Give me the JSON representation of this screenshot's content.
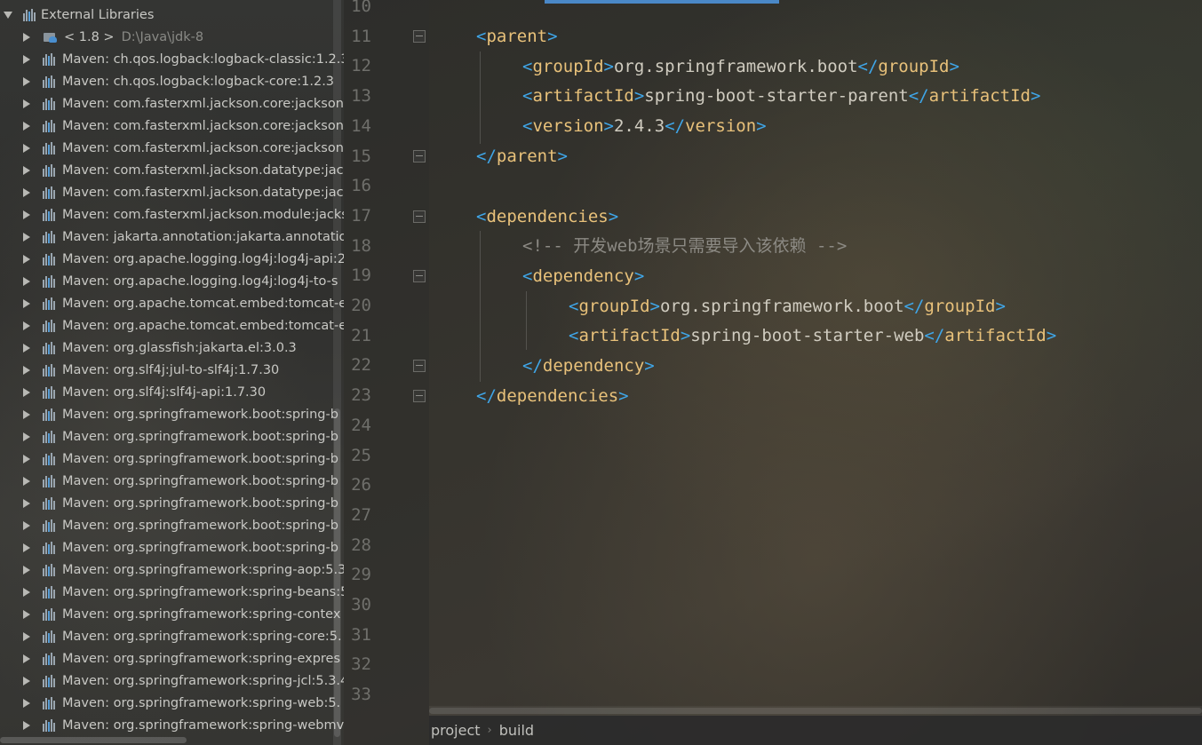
{
  "project_tree": {
    "root_label": "External Libraries",
    "jdk": {
      "label": "< 1.8 >",
      "path": "D:\\Java\\jdk-8"
    },
    "libraries": [
      "Maven: ch.qos.logback:logback-classic:1.2.3",
      "Maven: ch.qos.logback:logback-core:1.2.3",
      "Maven: com.fasterxml.jackson.core:jackson-",
      "Maven: com.fasterxml.jackson.core:jackson-",
      "Maven: com.fasterxml.jackson.core:jackson-",
      "Maven: com.fasterxml.jackson.datatype:jack",
      "Maven: com.fasterxml.jackson.datatype:jack",
      "Maven: com.fasterxml.jackson.module:jacks",
      "Maven: jakarta.annotation:jakarta.annotatio",
      "Maven: org.apache.logging.log4j:log4j-api:2",
      "Maven: org.apache.logging.log4j:log4j-to-s",
      "Maven: org.apache.tomcat.embed:tomcat-e",
      "Maven: org.apache.tomcat.embed:tomcat-e",
      "Maven: org.glassfish:jakarta.el:3.0.3",
      "Maven: org.slf4j:jul-to-slf4j:1.7.30",
      "Maven: org.slf4j:slf4j-api:1.7.30",
      "Maven: org.springframework.boot:spring-b",
      "Maven: org.springframework.boot:spring-b",
      "Maven: org.springframework.boot:spring-b",
      "Maven: org.springframework.boot:spring-b",
      "Maven: org.springframework.boot:spring-b",
      "Maven: org.springframework.boot:spring-b",
      "Maven: org.springframework.boot:spring-b",
      "Maven: org.springframework:spring-aop:5.3",
      "Maven: org.springframework:spring-beans:5",
      "Maven: org.springframework:spring-contex",
      "Maven: org.springframework:spring-core:5.",
      "Maven: org.springframework:spring-expres",
      "Maven: org.springframework:spring-jcl:5.3.4",
      "Maven: org.springframework:spring-web:5.",
      "Maven: org.springframework:spring-webmv"
    ]
  },
  "editor": {
    "line_numbers": [
      "10",
      "11",
      "12",
      "13",
      "14",
      "15",
      "16",
      "17",
      "18",
      "19",
      "20",
      "21",
      "22",
      "23",
      "24",
      "25",
      "26",
      "27",
      "28",
      "29",
      "30",
      "31",
      "32",
      "33"
    ],
    "code": {
      "l11": {
        "open": "<",
        "tag": "parent",
        "close": ">"
      },
      "l12": {
        "open": "<",
        "tag": "groupId",
        "mid": ">",
        "text": "org.springframework.boot",
        "end_open": "</",
        "end_tag": "groupId",
        "end_close": ">"
      },
      "l13": {
        "open": "<",
        "tag": "artifactId",
        "mid": ">",
        "text": "spring-boot-starter-parent",
        "end_open": "</",
        "end_tag": "artifactId",
        "end_close": ">"
      },
      "l14": {
        "open": "<",
        "tag": "version",
        "mid": ">",
        "text": "2.4.3",
        "end_open": "</",
        "end_tag": "version",
        "end_close": ">"
      },
      "l15": {
        "open": "</",
        "tag": "parent",
        "close": ">"
      },
      "l17": {
        "open": "<",
        "tag": "dependencies",
        "close": ">"
      },
      "l18": {
        "comment": "<!-- 开发web场景只需要导入该依赖 -->"
      },
      "l19": {
        "open": "<",
        "tag": "dependency",
        "close": ">"
      },
      "l20": {
        "open": "<",
        "tag": "groupId",
        "mid": ">",
        "text": "org.springframework.boot",
        "end_open": "</",
        "end_tag": "groupId",
        "end_close": ">"
      },
      "l21": {
        "open": "<",
        "tag": "artifactId",
        "mid": ">",
        "text": "spring-boot-starter-web",
        "end_open": "</",
        "end_tag": "artifactId",
        "end_close": ">"
      },
      "l22": {
        "open": "</",
        "tag": "dependency",
        "close": ">"
      },
      "l23": {
        "open": "</",
        "tag": "dependencies",
        "close": ">"
      }
    }
  },
  "breadcrumb": {
    "items": [
      "project",
      "build"
    ],
    "separator": "›"
  },
  "colors": {
    "tag": "#e8c17a",
    "bracket": "#3fa6e8",
    "comment": "#8c8a84",
    "accent": "#4a88c7"
  }
}
